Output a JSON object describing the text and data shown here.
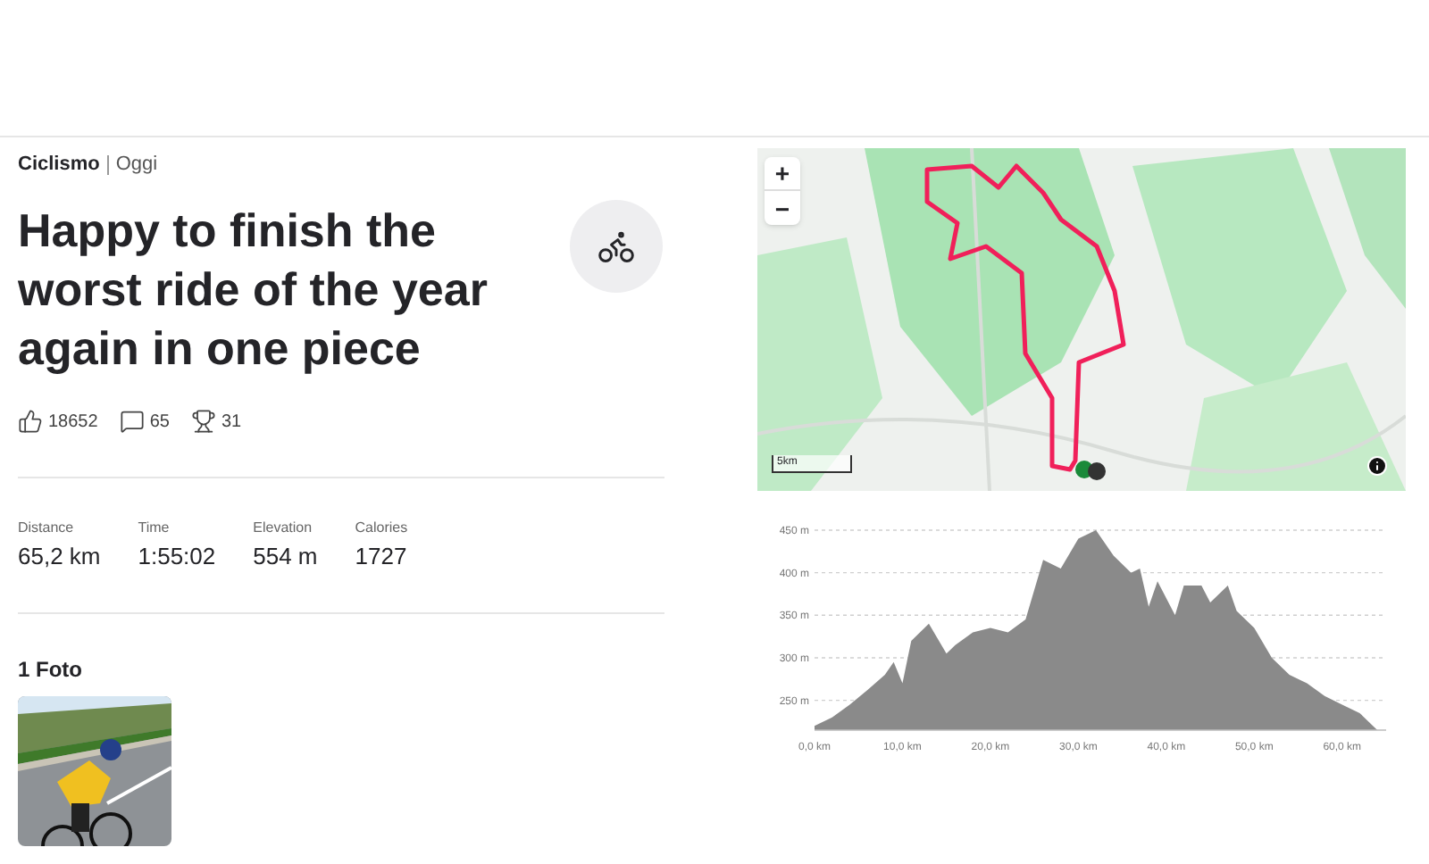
{
  "activity": {
    "sport": "Ciclismo",
    "date": "Oggi",
    "title": "Happy to finish the worst ride of the year again in one piece",
    "counts": [
      {
        "kind": "kudos",
        "value": "18652"
      },
      {
        "kind": "comments",
        "value": "65"
      },
      {
        "kind": "achievements",
        "value": "31"
      }
    ]
  },
  "stats": [
    {
      "label": "Distance",
      "value": "65,2 km"
    },
    {
      "label": "Time",
      "value": "1:55:02"
    },
    {
      "label": "Elevation",
      "value": "554 m"
    },
    {
      "label": "Calories",
      "value": "1727"
    }
  ],
  "photos": {
    "heading": "1 Foto"
  },
  "map": {
    "zoom_in": "+",
    "zoom_out": "−",
    "scale": "5km"
  },
  "elevation": {
    "chart_data": {
      "type": "area",
      "x": [
        0,
        2,
        4,
        6,
        8,
        9,
        10,
        11,
        13,
        15,
        16,
        18,
        20,
        22,
        24,
        26,
        28,
        30,
        32,
        34,
        36,
        37,
        38,
        39,
        41,
        42,
        44,
        45,
        46,
        47,
        48,
        50,
        52,
        54,
        56,
        58,
        60,
        62,
        64
      ],
      "series": [
        {
          "color": "#8a8a8a",
          "values": [
            220,
            230,
            245,
            262,
            280,
            295,
            270,
            320,
            340,
            305,
            315,
            330,
            335,
            330,
            345,
            415,
            405,
            440,
            450,
            420,
            400,
            405,
            360,
            390,
            350,
            385,
            385,
            365,
            375,
            385,
            355,
            335,
            300,
            280,
            270,
            255,
            245,
            235,
            215
          ]
        }
      ],
      "xlim": [
        0,
        65
      ],
      "ylim": [
        215,
        450
      ],
      "grid": true,
      "xticks": [
        {
          "value": 0,
          "label": "0,0 km"
        },
        {
          "value": 10,
          "label": "10,0 km"
        },
        {
          "value": 20,
          "label": "20,0 km"
        },
        {
          "value": 30,
          "label": "30,0 km"
        },
        {
          "value": 40,
          "label": "40,0 km"
        },
        {
          "value": 50,
          "label": "50,0 km"
        },
        {
          "value": 60,
          "label": "60,0 km"
        }
      ],
      "yticks": [
        {
          "value": 250,
          "label": "250 m"
        },
        {
          "value": 300,
          "label": "300 m"
        },
        {
          "value": 350,
          "label": "350 m"
        },
        {
          "value": 400,
          "label": "400 m"
        },
        {
          "value": 450,
          "label": "450 m"
        }
      ]
    }
  }
}
